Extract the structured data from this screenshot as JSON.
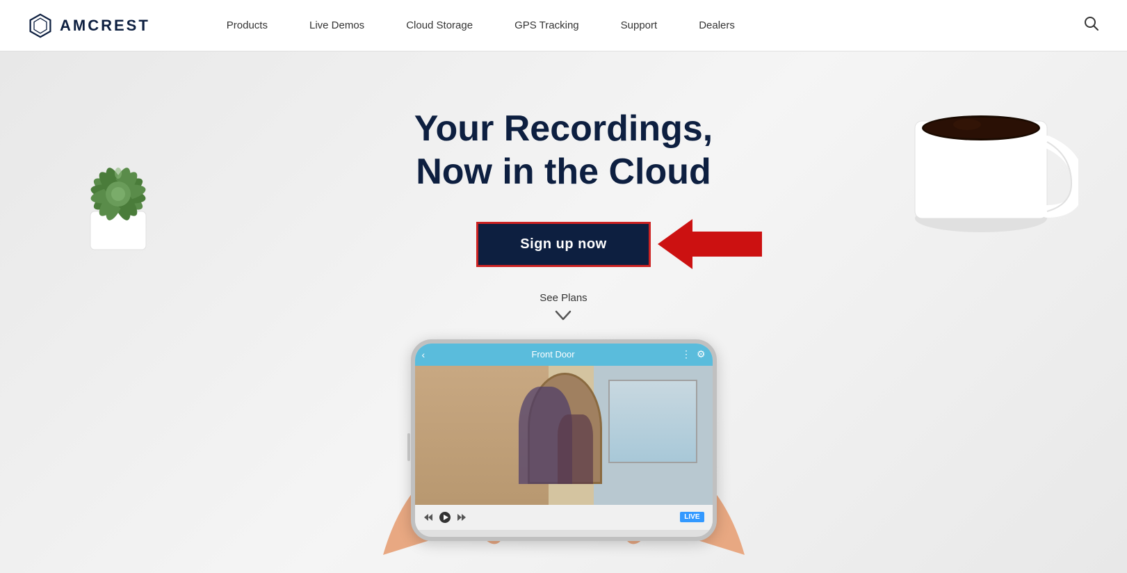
{
  "brand": {
    "name": "AMCREST",
    "logo_alt": "Amcrest logo"
  },
  "navbar": {
    "links": [
      {
        "id": "products",
        "label": "Products"
      },
      {
        "id": "live-demos",
        "label": "Live Demos"
      },
      {
        "id": "cloud-storage",
        "label": "Cloud Storage"
      },
      {
        "id": "gps-tracking",
        "label": "GPS Tracking"
      },
      {
        "id": "support",
        "label": "Support"
      },
      {
        "id": "dealers",
        "label": "Dealers"
      }
    ],
    "search_aria": "Search"
  },
  "hero": {
    "title_line1": "Your Recordings,",
    "title_line2": "Now in the Cloud",
    "cta_button": "Sign up now",
    "see_plans": "See Plans",
    "chevron": "∨",
    "phone_label": "Front Door"
  },
  "colors": {
    "brand_dark": "#0d1f40",
    "accent_red": "#cc1111",
    "nav_bg": "#ffffff",
    "hero_bg": "#f5f5f5"
  }
}
